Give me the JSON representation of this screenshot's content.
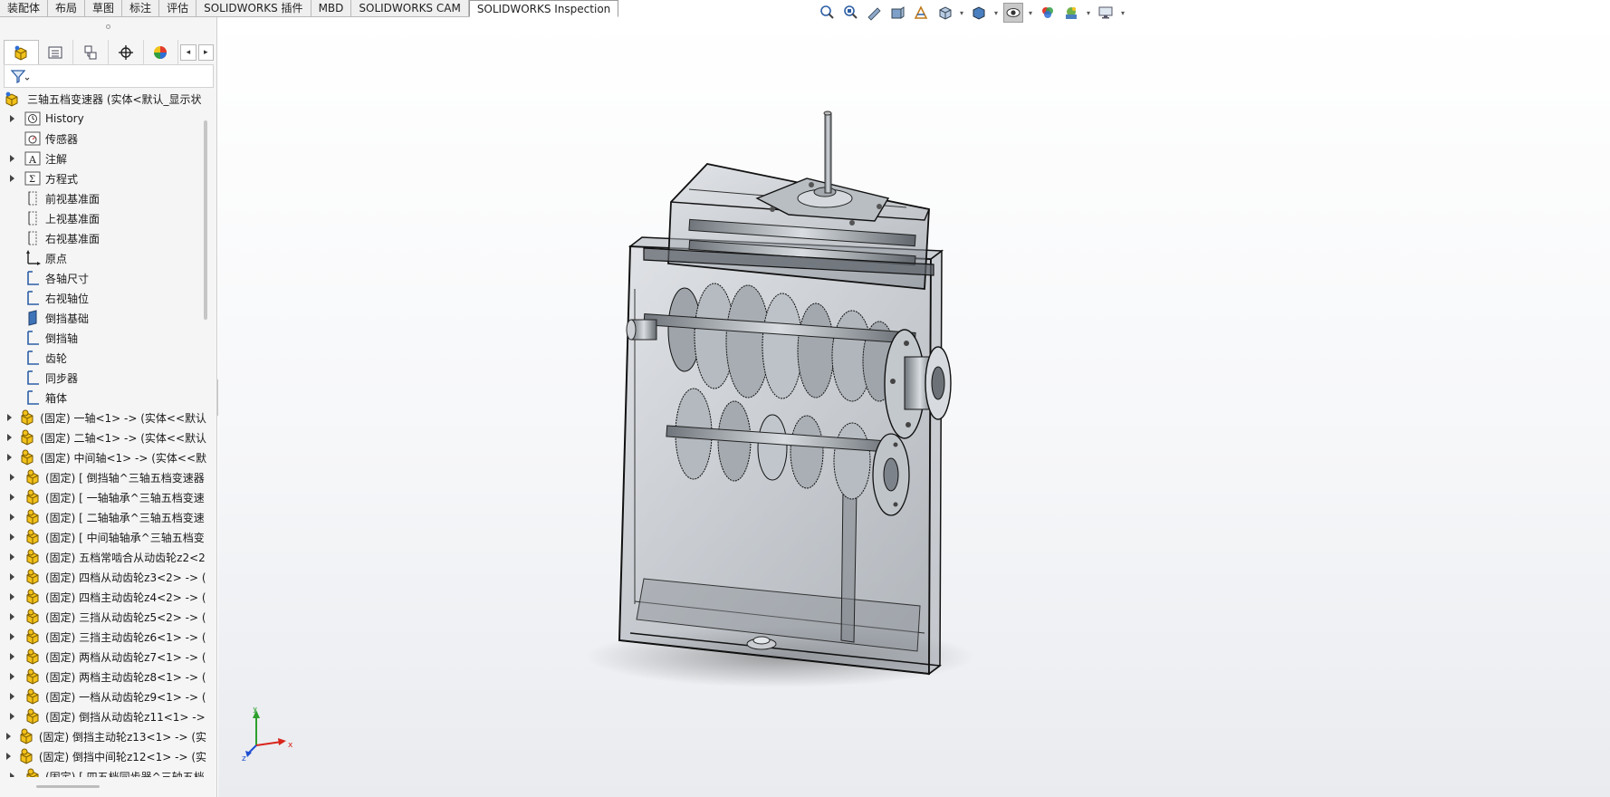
{
  "command_tabs": [
    "装配体",
    "布局",
    "草图",
    "标注",
    "评估",
    "SOLIDWORKS 插件",
    "MBD",
    "SOLIDWORKS CAM",
    "SOLIDWORKS Inspection"
  ],
  "active_tab": "SOLIDWORKS Inspection",
  "hud_icons": [
    "zoom-to-fit-icon",
    "zoom-to-area-icon",
    "previous-view-icon",
    "section-view-icon",
    "dynamic-annotation-icon",
    "view-orientation-icon",
    "display-style-icon",
    "hide-show-items-icon",
    "edit-appearance-icon",
    "apply-scene-icon",
    "view-settings-icon"
  ],
  "feature_tree": {
    "root": "三轴五档变速器  (实体<默认_显示状",
    "items": [
      {
        "label": "History",
        "icon": "history-icon",
        "expandable": true
      },
      {
        "label": "传感器",
        "icon": "sensor-icon",
        "expandable": false
      },
      {
        "label": "注解",
        "icon": "annotation-icon",
        "expandable": true
      },
      {
        "label": "方程式",
        "icon": "equation-icon",
        "expandable": true
      },
      {
        "label": "前视基准面",
        "icon": "plane-icon",
        "expandable": false
      },
      {
        "label": "上视基准面",
        "icon": "plane-icon",
        "expandable": false
      },
      {
        "label": "右视基准面",
        "icon": "plane-icon",
        "expandable": false
      },
      {
        "label": "原点",
        "icon": "origin-icon",
        "expandable": false
      },
      {
        "label": "各轴尺寸",
        "icon": "sketch-icon",
        "expandable": false
      },
      {
        "label": "右视轴位",
        "icon": "sketch-icon",
        "expandable": false
      },
      {
        "label": "倒挡基础",
        "icon": "sketch-3d-icon",
        "expandable": false
      },
      {
        "label": "倒挡轴",
        "icon": "sketch-icon",
        "expandable": false
      },
      {
        "label": "齿轮",
        "icon": "sketch-icon",
        "expandable": false
      },
      {
        "label": "同步器",
        "icon": "sketch-icon",
        "expandable": false
      },
      {
        "label": "箱体",
        "icon": "sketch-icon",
        "expandable": false
      },
      {
        "label": "(固定) 一轴<1> -> (实体<<默认",
        "icon": "part-icon",
        "expandable": true
      },
      {
        "label": "(固定) 二轴<1> -> (实体<<默认",
        "icon": "part-icon",
        "expandable": true
      },
      {
        "label": "(固定) 中间轴<1> -> (实体<<默",
        "icon": "part-icon",
        "expandable": true
      },
      {
        "label": "(固定) [ 倒挡轴^三轴五档变速器",
        "icon": "part-icon",
        "expandable": true
      },
      {
        "label": "(固定) [ 一轴轴承^三轴五档变速",
        "icon": "part-icon",
        "expandable": true
      },
      {
        "label": "(固定) [ 二轴轴承^三轴五档变速",
        "icon": "part-icon",
        "expandable": true
      },
      {
        "label": "(固定) [ 中间轴轴承^三轴五档变",
        "icon": "part-icon",
        "expandable": true
      },
      {
        "label": "(固定) 五档常啮合从动齿轮z2<2",
        "icon": "part-icon",
        "expandable": true
      },
      {
        "label": "(固定) 四档从动齿轮z3<2> -> (",
        "icon": "part-icon",
        "expandable": true
      },
      {
        "label": "(固定) 四档主动齿轮z4<2> -> (",
        "icon": "part-icon",
        "expandable": true
      },
      {
        "label": "(固定) 三挡从动齿轮z5<2> -> (",
        "icon": "part-icon",
        "expandable": true
      },
      {
        "label": "(固定) 三挡主动齿轮z6<1> -> (",
        "icon": "part-icon",
        "expandable": true
      },
      {
        "label": "(固定) 两档从动齿轮z7<1> -> (",
        "icon": "part-icon",
        "expandable": true
      },
      {
        "label": "(固定) 两档主动齿轮z8<1> -> (",
        "icon": "part-icon",
        "expandable": true
      },
      {
        "label": "(固定) 一档从动齿轮z9<1> -> (",
        "icon": "part-icon",
        "expandable": true
      },
      {
        "label": "(固定) 倒挡从动齿轮z11<1> ->",
        "icon": "part-icon",
        "expandable": true
      },
      {
        "label": "(固定) 倒挡主动轮z13<1> -> (实",
        "icon": "part-icon",
        "expandable": true
      },
      {
        "label": "(固定) 倒挡中间轮z12<1> -> (实",
        "icon": "part-icon",
        "expandable": true
      },
      {
        "label": "(固定) [ 四五档同步器^三轴五档",
        "icon": "part-icon",
        "expandable": true
      }
    ]
  },
  "triad": {
    "x": "x",
    "y": "y",
    "z": "z"
  },
  "colors": {
    "accent": "#f2c21b",
    "background": "#ffffff",
    "panel": "#f5f5f5",
    "x_axis": "#d9261c",
    "y_axis": "#2ca02c",
    "z_axis": "#1f4fd1"
  }
}
